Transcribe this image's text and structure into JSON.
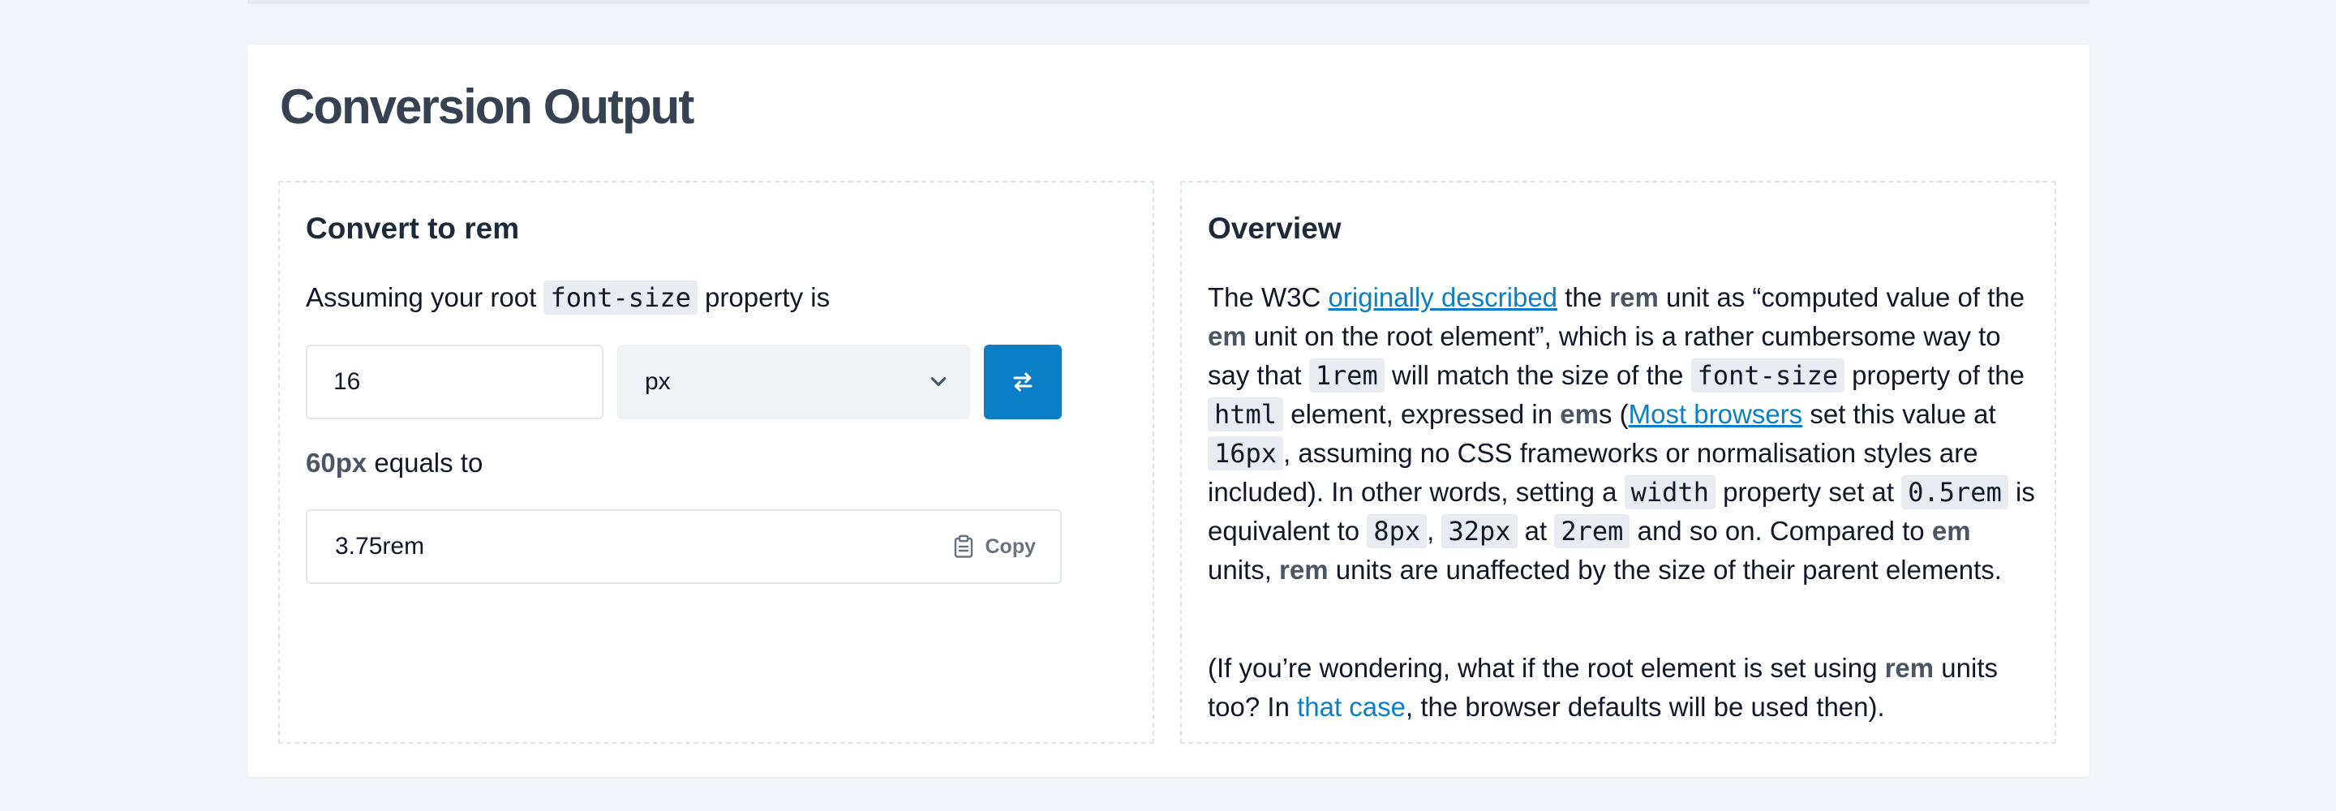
{
  "card": {
    "title": "Conversion Output"
  },
  "converter": {
    "heading": "Convert to rem",
    "assume_prefix": "Assuming your root",
    "assume_code": "font-size",
    "assume_suffix": "property is",
    "input_value": "16",
    "unit_selected": "px",
    "swap_icon": "swap-arrows-icon",
    "equals_value": "60px",
    "equals_text": "equals to",
    "result_value": "3.75rem",
    "copy_label": "Copy",
    "copy_icon": "clipboard-icon"
  },
  "overview": {
    "heading": "Overview",
    "p1": {
      "t1": "The W3C ",
      "link1": "originally described",
      "t2": " the ",
      "b1": "rem",
      "t3": " unit as “computed value of the ",
      "b2": "em",
      "t4": " unit on the root element”, which is a rather cumbersome way to say that ",
      "c1": "1rem",
      "t5": " will match the size of the ",
      "c2": "font-size",
      "t6": " property of the ",
      "c3": "html",
      "t7": " element, expressed in ",
      "b3": "em",
      "t8": "s (",
      "link2": "Most browsers",
      "t9": " set this value at ",
      "c4": "16px",
      "t10": ", assuming no CSS frameworks or normalisation styles are included). In other words, setting a ",
      "c5": "width",
      "t11": " property set at ",
      "c6": "0.5rem",
      "t12": " is equivalent to ",
      "c7": "8px",
      "t13": ", ",
      "c8": "32px",
      "t14": " at ",
      "c9": "2rem",
      "t15": " and so on. Compared to ",
      "b4": "em",
      "t16": " units, ",
      "b5": "rem",
      "t17": " units are unaffected by the size of their parent elements."
    },
    "p2": {
      "t1": "(If you’re wondering, what if the root element is set using ",
      "b1": "rem",
      "t2": " units too? In ",
      "link1": "that case",
      "t3": ", the browser defaults will be used then)."
    }
  },
  "colors": {
    "accent": "#0b7fc5",
    "page_bg": "#f1f4f8",
    "card_bg": "#ffffff",
    "heading": "#374151"
  }
}
